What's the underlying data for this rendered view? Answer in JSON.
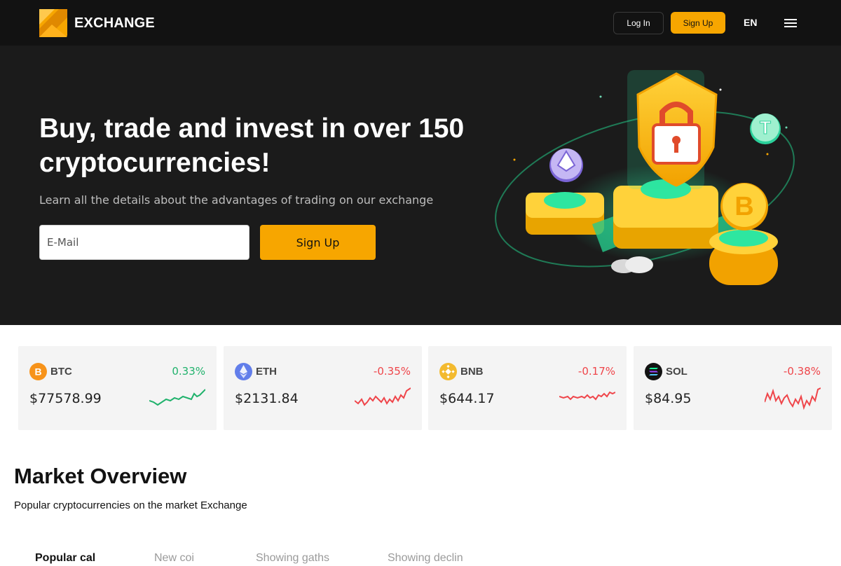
{
  "header": {
    "logo_text": "EXCHANGE",
    "login_label": "Log In",
    "signup_label": "Sign Up",
    "language": "EN"
  },
  "hero": {
    "title": "Buy, trade and invest in over 150 cryptocurrencies!",
    "subtitle": "Learn all the details about the advantages of trading on our exchange",
    "email_placeholder": "E-Mail",
    "signup_label": "Sign Up"
  },
  "tickers": [
    {
      "symbol": "BTC",
      "price": "$77578.99",
      "change": "0.33%",
      "direction": "up",
      "icon": "bitcoin-icon",
      "color": "#f7931a"
    },
    {
      "symbol": "ETH",
      "price": "$2131.84",
      "change": "-0.35%",
      "direction": "down",
      "icon": "ethereum-icon",
      "color": "#627eea"
    },
    {
      "symbol": "BNB",
      "price": "$644.17",
      "change": "-0.17%",
      "direction": "down",
      "icon": "bnb-icon",
      "color": "#f3ba2f"
    },
    {
      "symbol": "SOL",
      "price": "$84.95",
      "change": "-0.38%",
      "direction": "down",
      "icon": "solana-icon",
      "color": "#121212"
    }
  ],
  "overview": {
    "title": "Market Overview",
    "subtitle": "Popular cryptocurrencies on the market Exchange",
    "tabs": [
      "Popular cal",
      "New coi",
      "Showing gaths",
      "Showing declin"
    ]
  },
  "colors": {
    "accent": "#f7a600",
    "up": "#20b26c",
    "down": "#ef454a",
    "header_bg": "#121212",
    "hero_bg": "#1b1b1b"
  }
}
